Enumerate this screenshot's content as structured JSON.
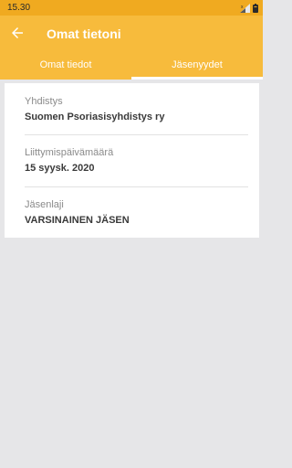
{
  "status_bar": {
    "time": "15.30",
    "signal_icon": "signal-icon",
    "battery_icon": "battery-icon"
  },
  "app_bar": {
    "back_icon": "back-arrow-icon",
    "title": "Omat tietoni"
  },
  "tabs": [
    {
      "label": "Omat tiedot",
      "active": false
    },
    {
      "label": "Jäsenyydet",
      "active": true
    }
  ],
  "membership": {
    "fields": [
      {
        "label": "Yhdistys",
        "value": "Suomen Psoriasisyhdistys ry"
      },
      {
        "label": "Liittymispäivämäärä",
        "value": "15 syysk. 2020"
      },
      {
        "label": "Jäsenlaji",
        "value": "VARSINAINEN JÄSEN"
      }
    ]
  },
  "colors": {
    "accent": "#f7bb3c",
    "status_bar": "#f0aa20",
    "background": "#e6e6e8"
  }
}
